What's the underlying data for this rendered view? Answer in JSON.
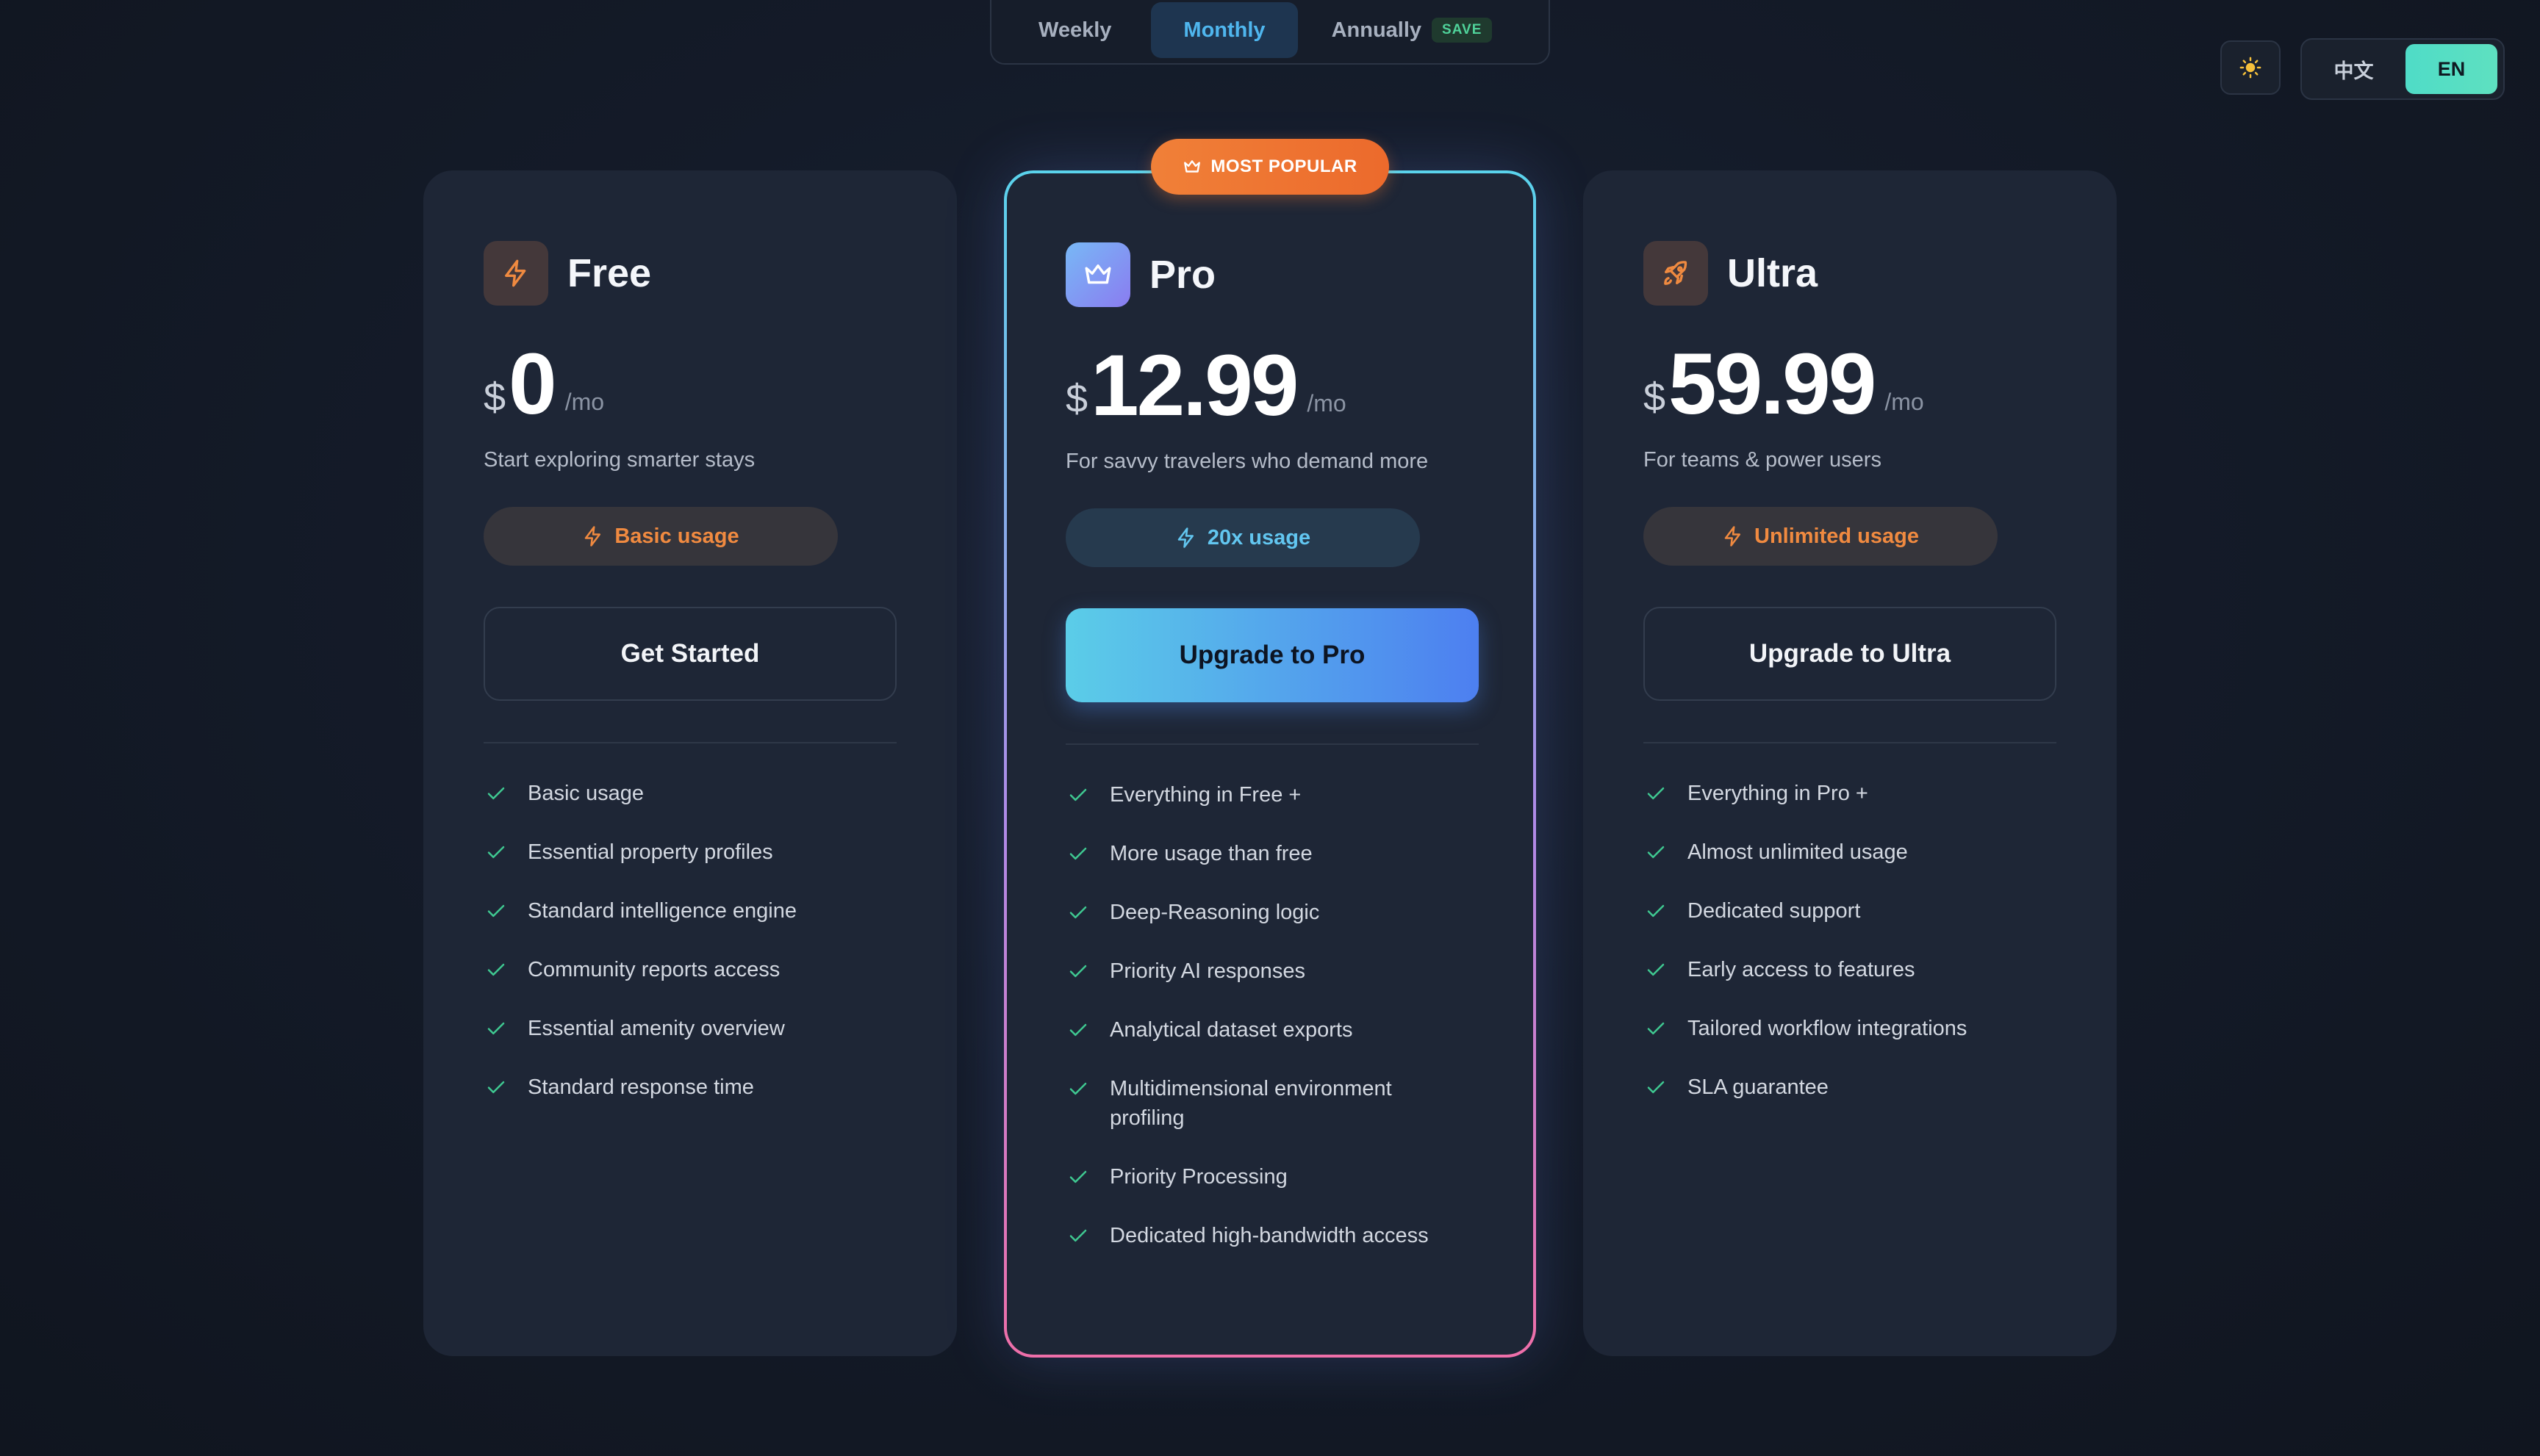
{
  "billing": {
    "options": [
      "Weekly",
      "Monthly",
      "Annually"
    ],
    "selected": "Monthly",
    "save_badge": "SAVE"
  },
  "theme_toggle": {
    "icon": "sun-icon"
  },
  "language": {
    "options": [
      "中文",
      "EN"
    ],
    "selected": "EN"
  },
  "popular_badge": "MOST POPULAR",
  "plans": [
    {
      "name": "Free",
      "icon": "lightning-icon",
      "currency": "$",
      "price": "0",
      "period": "/mo",
      "tagline": "Start exploring smarter stays",
      "usage": "Basic usage",
      "cta": "Get Started",
      "features": [
        "Basic usage",
        "Essential property profiles",
        "Standard intelligence engine",
        "Community reports access",
        "Essential amenity overview",
        "Standard response time"
      ]
    },
    {
      "name": "Pro",
      "icon": "crown-icon",
      "currency": "$",
      "price": "12.99",
      "period": "/mo",
      "tagline": "For savvy travelers who demand more",
      "usage": "20x usage",
      "cta": "Upgrade to Pro",
      "features": [
        "Everything in Free +",
        "More usage than free",
        "Deep-Reasoning logic",
        "Priority AI responses",
        "Analytical dataset exports",
        "Multidimensional environment profiling",
        "Priority Processing",
        "Dedicated high-bandwidth access"
      ]
    },
    {
      "name": "Ultra",
      "icon": "rocket-icon",
      "currency": "$",
      "price": "59.99",
      "period": "/mo",
      "tagline": "For teams & power users",
      "usage": "Unlimited usage",
      "cta": "Upgrade to Ultra",
      "features": [
        "Everything in Pro +",
        "Almost unlimited usage",
        "Dedicated support",
        "Early access to features",
        "Tailored workflow integrations",
        "SLA guarantee"
      ]
    }
  ],
  "colors": {
    "accent_orange": "#f08a40",
    "accent_blue": "#62c6f0",
    "check_green": "#3fc891",
    "background": "#141b29"
  }
}
